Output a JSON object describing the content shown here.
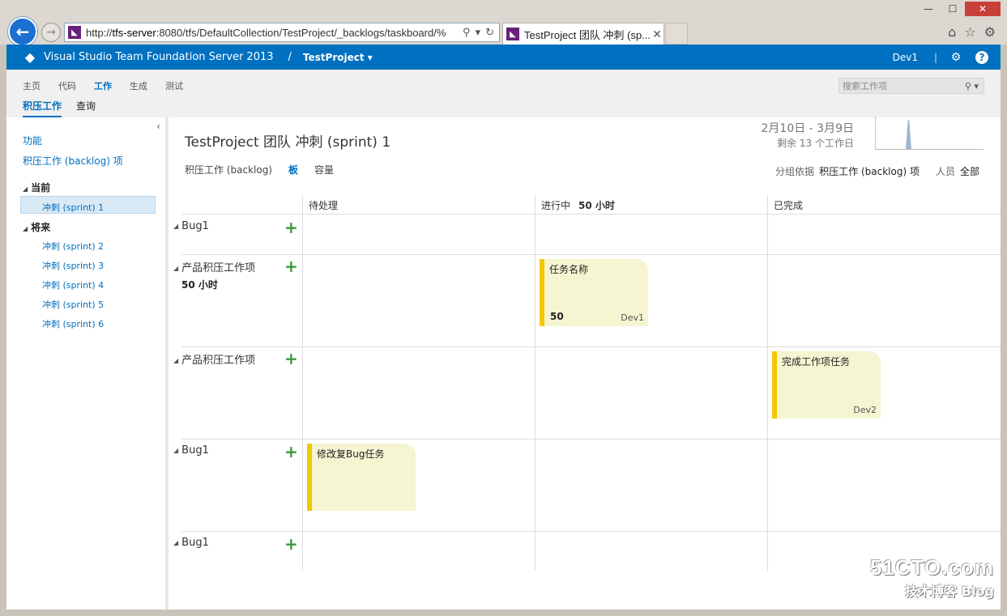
{
  "browser": {
    "address_prefix": "http://",
    "address_host": "tfs-server",
    "address_rest": ":8080/tfs/DefaultCollection/TestProject/_backlogs/taskboard/%",
    "tab_title": "TestProject 团队 冲刺 (sp...",
    "tab_close": "✕",
    "win_minimize": "—",
    "win_maximize": "☐",
    "win_close": "✕"
  },
  "header": {
    "product": "Visual Studio Team Foundation Server 2013",
    "separator": "/",
    "project": "TestProject ▾",
    "user": "Dev1",
    "pipe": "|"
  },
  "hub_nav": {
    "items": [
      "主页",
      "代码",
      "工作",
      "生成",
      "测试"
    ],
    "sub_items": [
      "积压工作",
      "查询"
    ],
    "search_placeholder": "搜索工作项"
  },
  "left_nav": {
    "links": [
      "功能",
      "积压工作 (backlog) 项"
    ],
    "current_heading": "当前",
    "current_sprint": "冲刺 (sprint) 1",
    "future_heading": "将来",
    "future_sprints": [
      "冲刺 (sprint) 2",
      "冲刺 (sprint) 3",
      "冲刺 (sprint) 4",
      "冲刺 (sprint) 5",
      "冲刺 (sprint) 6"
    ]
  },
  "board": {
    "title": "TestProject 团队 冲刺 (sprint) 1",
    "dates": "2月10日 - 3月9日",
    "remaining": "剩余 13 个工作日",
    "views": [
      "积压工作 (backlog)",
      "板",
      "容量"
    ],
    "group_by_label": "分组依据",
    "group_by_value": "积压工作 (backlog) 项",
    "people_label": "人员",
    "people_value": "全部",
    "columns": [
      {
        "name": "待处理",
        "effort": ""
      },
      {
        "name": "进行中",
        "effort": "50 小时"
      },
      {
        "name": "已完成",
        "effort": ""
      }
    ],
    "rows": [
      {
        "label": "Bug1",
        "effort": ""
      },
      {
        "label": "产品积压工作项",
        "effort": "50 小时"
      },
      {
        "label": "产品积压工作项",
        "effort": ""
      },
      {
        "label": "Bug1",
        "effort": ""
      },
      {
        "label": "Bug1",
        "effort": ""
      }
    ],
    "cards": [
      {
        "title": "任务名称",
        "remaining": "50",
        "owner": "Dev1"
      },
      {
        "title": "完成工作项任务",
        "remaining": "",
        "owner": "Dev2"
      },
      {
        "title": "修改复Bug任务",
        "remaining": "",
        "owner": ""
      }
    ]
  },
  "watermark": {
    "site": "51CTO.com",
    "tagline": "技术博客",
    "blog": "Blog"
  }
}
